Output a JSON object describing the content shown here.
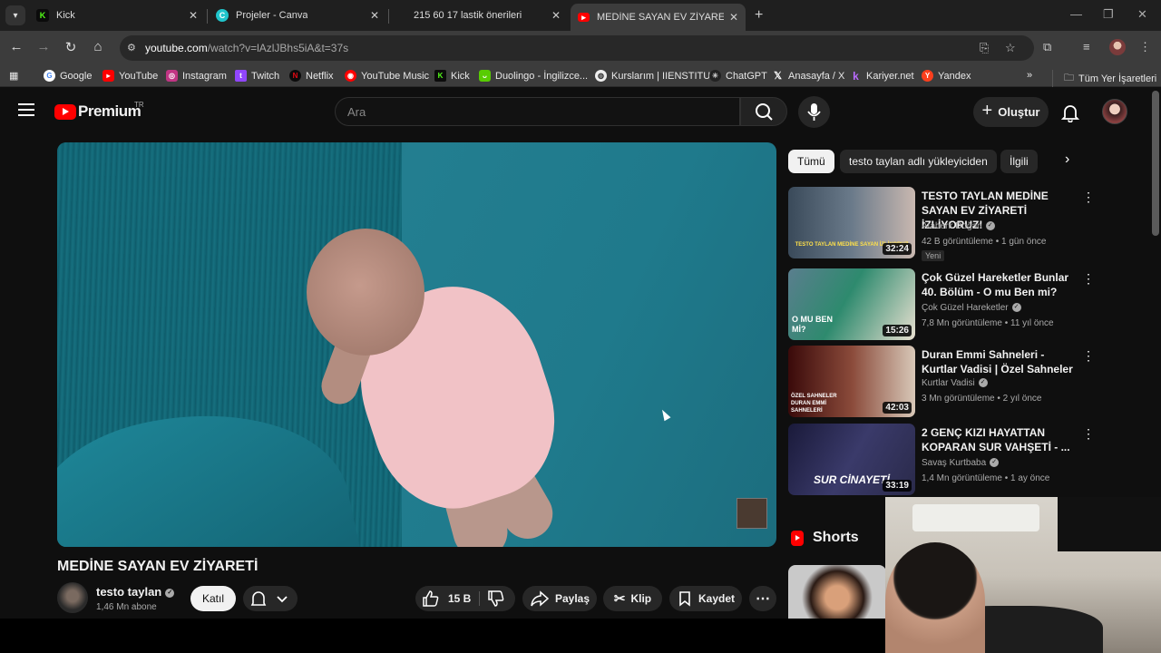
{
  "browser": {
    "tabs": [
      {
        "title": "Kick",
        "icon": "kick-icon",
        "color": "#53fc18"
      },
      {
        "title": "Projeler - Canva",
        "icon": "canva-icon",
        "color": "#20c4cb"
      },
      {
        "title": "215 60 17 lastik önerileri",
        "icon": "",
        "color": ""
      },
      {
        "title": "MEDİNE SAYAN EV ZİYARETİ - Y",
        "icon": "youtube-icon",
        "color": "#ff0000"
      }
    ],
    "url_host": "youtube.com",
    "url_path": "/watch?v=lAzlJBhs5iA&t=37s",
    "bookmarks": [
      {
        "label": "Google",
        "color": "#4285f4"
      },
      {
        "label": "YouTube",
        "color": "#ff0000"
      },
      {
        "label": "Instagram",
        "color": "#c13584"
      },
      {
        "label": "Twitch",
        "color": "#9146ff"
      },
      {
        "label": "Netflix",
        "color": "#e50914"
      },
      {
        "label": "YouTube Music",
        "color": "#ff0000"
      },
      {
        "label": "Kick",
        "color": "#53fc18"
      },
      {
        "label": "Duolingo - İngilizce...",
        "color": "#58cc02"
      },
      {
        "label": "Kurslarım | IIENSTITU",
        "color": "#888888"
      },
      {
        "label": "ChatGPT",
        "color": "#222222"
      },
      {
        "label": "Anasayfa / X",
        "color": "#000000"
      },
      {
        "label": "Kariyer.net",
        "color": "#8a2be2"
      },
      {
        "label": "Yandex",
        "color": "#fc3f1d"
      }
    ],
    "all_bookmarks": "Tüm Yer İşaretleri"
  },
  "yt": {
    "logo_word": "Premium",
    "region": "TR",
    "search_placeholder": "Ara",
    "create_label": "Oluştur",
    "video": {
      "title": "MEDİNE SAYAN EV ZİYARETİ",
      "channel": "testo taylan",
      "subscribers": "1,46 Mn abone",
      "join": "Katıl",
      "likes": "15 B",
      "share": "Paylaş",
      "clip": "Klip",
      "save": "Kaydet"
    },
    "chips": [
      "Tümü",
      "testo taylan adlı yükleyiciden",
      "İlgili"
    ],
    "recommendations": [
      {
        "title": "TESTO TAYLAN MEDİNE SAYAN EV ZİYARETİ İZLİYORUZ!",
        "channel": "Ataberk Doğan",
        "meta": "42 B görüntüleme • 1 gün önce",
        "badge": "Yeni",
        "duration": "32:24"
      },
      {
        "title": "Çok Güzel Hareketler Bunlar 40. Bölüm - O mu Ben mi?",
        "channel": "Çok Güzel Hareketler",
        "meta": "7,8 Mn görüntüleme • 11 yıl önce",
        "badge": "",
        "duration": "15:26"
      },
      {
        "title": "Duran Emmi Sahneleri - Kurtlar Vadisi | Özel Sahneler",
        "channel": "Kurtlar Vadisi",
        "meta": "3 Mn görüntüleme • 2 yıl önce",
        "badge": "",
        "duration": "42:03"
      },
      {
        "title": "2 GENÇ KIZI HAYATTAN KOPARAN SUR VAHŞETİ - ...",
        "channel": "Savaş Kurtbaba",
        "meta": "1,4 Mn görüntüleme • 1 ay önce",
        "badge": "",
        "duration": "33:19"
      }
    ],
    "thumb_texts": [
      "TESTO TAYLAN MEDİNE SAYAN İZLİYORUZ",
      "O MU BEN Mİ?",
      "ÖZEL SAHNELER DURAN EMMİ SAHNELERİ",
      "SUR CİNAYETİ"
    ],
    "shorts_label": "Shorts"
  }
}
